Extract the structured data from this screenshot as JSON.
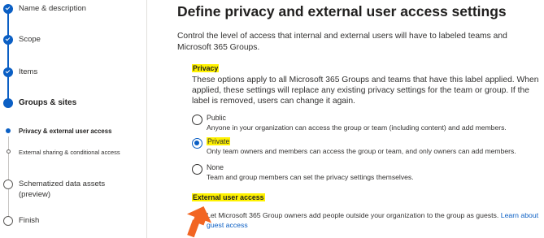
{
  "nav": {
    "steps": [
      {
        "label": "Name & description",
        "state": "done"
      },
      {
        "label": "Scope",
        "state": "done"
      },
      {
        "label": "Items",
        "state": "done"
      },
      {
        "label": "Groups & sites",
        "state": "current"
      },
      {
        "label": "Privacy & external user access",
        "state": "current-sub"
      },
      {
        "label": "External sharing & conditional access",
        "state": "todo-sub"
      },
      {
        "label": "Schematized data assets (preview)",
        "state": "todo"
      },
      {
        "label": "Finish",
        "state": "todo"
      }
    ]
  },
  "main": {
    "title": "Define privacy and external user access settings",
    "description": "Control the level of access that internal and external users will have to labeled teams and Microsoft 365 Groups.",
    "privacy": {
      "heading": "Privacy",
      "text": "These options apply to all Microsoft 365 Groups and teams that have this label applied. When applied, these settings will replace any existing privacy settings for the team or group. If the label is removed, users can change it again.",
      "options": [
        {
          "label": "Public",
          "desc": "Anyone in your organization can access the group or team (including content) and add members.",
          "checked": false
        },
        {
          "label": "Private",
          "desc": "Only team owners and members can access the group or team, and only owners can add members.",
          "checked": true
        },
        {
          "label": "None",
          "desc": "Team and group members can set the privacy settings themselves.",
          "checked": false
        }
      ]
    },
    "external": {
      "heading": "External user access",
      "text_prefix": "Let Microsoft 365 Group owners add people outside your organization to the group as guests.",
      "link_text": "Learn about guest access"
    }
  },
  "colors": {
    "accent": "#0b5fc4",
    "highlight": "#fff200",
    "cursor": "#f26522"
  }
}
